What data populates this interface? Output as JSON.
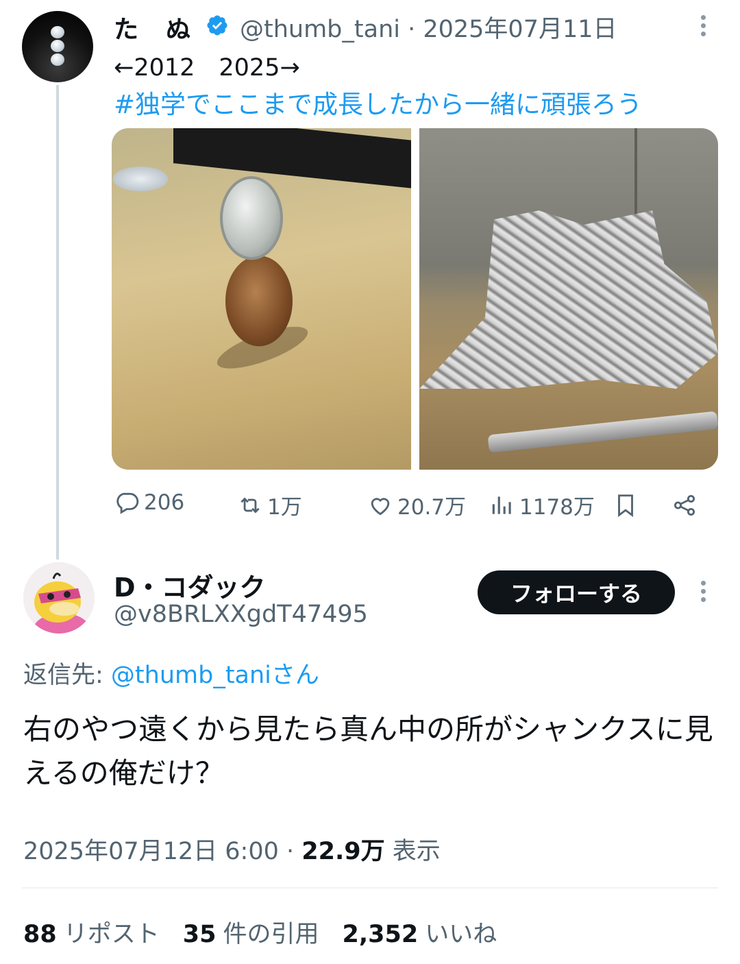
{
  "parent_tweet": {
    "display_name": "た　ぬ",
    "handle_and_date": "@thumb_tani · 2025年07月11日",
    "text_line": "←2012　2025→",
    "hashtag": "#独学でここまで成長したから一緒に頑張ろう",
    "actions": {
      "replies": "206",
      "reposts": "1万",
      "likes": "20.7万",
      "views": "1178万"
    }
  },
  "reply_tweet": {
    "display_name": "D・コダック",
    "handle": "@v8BRLXXgdT47495",
    "follow_label": "フォローする",
    "reply_to_prefix": "返信先: ",
    "reply_to_mention": "@thumb_tani",
    "reply_to_suffix": "さん",
    "text": "右のやつ遠くから見たら真ん中の所がシャンクスに見えるの俺だけ？",
    "timestamp": "2025年07月12日 6:00 · ",
    "views_count": "22.9万",
    "views_label": " 表示"
  },
  "stats": {
    "reposts_count": "88",
    "reposts_label": "リポスト",
    "quotes_count": "35",
    "quotes_label": "件の引用",
    "likes_count": "2,352",
    "likes_label": "いいね"
  },
  "colors": {
    "accent": "#1d9bf0",
    "text_primary": "#0f1419",
    "text_secondary": "#536471",
    "button_bg": "#0f1419"
  },
  "icons": {
    "verified": "verified-badge-icon",
    "reply": "reply-icon",
    "repost": "repost-icon",
    "like": "heart-icon",
    "views": "views-icon",
    "bookmark": "bookmark-icon",
    "share": "share-icon",
    "more": "more-vertical-icon"
  }
}
